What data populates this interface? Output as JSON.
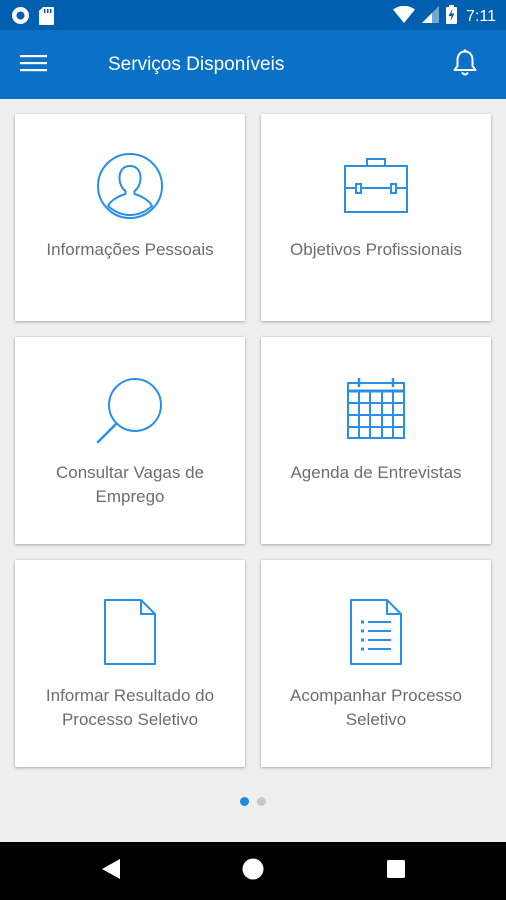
{
  "status_bar": {
    "time": "7:11",
    "left_icons": [
      "circle-notification-icon",
      "sd-card-icon"
    ],
    "right_icons": [
      "wifi-icon",
      "cellular-signal-icon",
      "battery-charging-icon"
    ]
  },
  "app_bar": {
    "title": "Serviços Disponíveis",
    "menu_icon": "hamburger-menu-icon",
    "notification_icon": "bell-icon"
  },
  "tiles": [
    {
      "label": "Informações Pessoais",
      "icon": "user-profile-icon"
    },
    {
      "label": "Objetivos Profissionais",
      "icon": "briefcase-icon"
    },
    {
      "label": "Consultar Vagas de Emprego",
      "icon": "search-icon"
    },
    {
      "label": "Agenda de Entrevistas",
      "icon": "calendar-icon"
    },
    {
      "label": "Informar Resultado do Processo Seletivo",
      "icon": "blank-document-icon"
    },
    {
      "label": "Acompanhar Processo Seletivo",
      "icon": "document-list-icon"
    }
  ],
  "pagination": {
    "pages": 2,
    "current": 1
  },
  "nav_bar": {
    "buttons": [
      "back-icon",
      "home-icon",
      "recents-icon"
    ]
  },
  "colors": {
    "status_bar": "#005fae",
    "app_bar": "#0a71c6",
    "icon_blue": "#2a8fe6",
    "label_gray": "#6d6d6d",
    "background": "#efefef",
    "dot_active": "#1e88e5",
    "dot_inactive": "#c8c8c8"
  }
}
